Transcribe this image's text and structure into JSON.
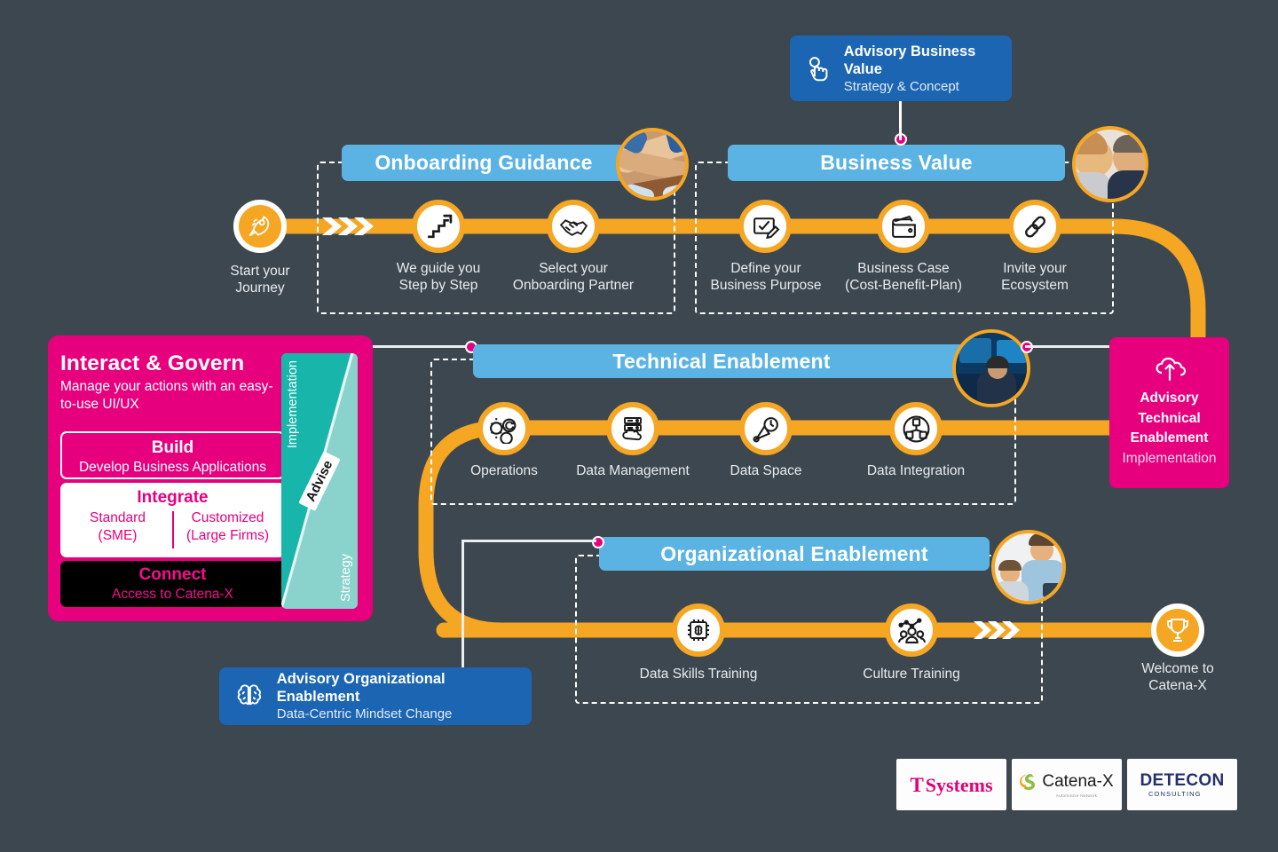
{
  "background_color": "#3d4750",
  "palette": {
    "orange": "#f5a623",
    "blue_bar": "#5bb3e4",
    "advisory_blue": "#1b65b3",
    "pink": "#e6007e",
    "teal_dark": "#18b5ab",
    "teal_light": "#8ad3cd"
  },
  "callouts": {
    "business_value": {
      "icon": "click-hand-icon",
      "title": "Advisory Business Value",
      "subtitle": "Strategy & Concept"
    },
    "organizational": {
      "icon": "brain-icon",
      "title": "Advisory Organizational Enablement",
      "subtitle": "Data-Centric Mindset Change"
    },
    "technical": {
      "icon": "cloud-upload-icon",
      "title": "Advisory Technical Enablement",
      "title_lines": [
        "Advisory",
        "Technical",
        "Enablement"
      ],
      "subtitle": "Implementation"
    }
  },
  "sections": [
    {
      "id": "onboarding",
      "label": "Onboarding Guidance"
    },
    {
      "id": "business-value",
      "label": "Business Value"
    },
    {
      "id": "technical-enablement",
      "label": "Technical Enablement"
    },
    {
      "id": "organizational-enablement",
      "label": "Organizational Enablement"
    }
  ],
  "nodes": {
    "start": {
      "label": "Start your\nJourney",
      "icon": "rocket-icon"
    },
    "guide": {
      "label": "We guide you\nStep by Step",
      "icon": "stairs-arrow-icon"
    },
    "partner": {
      "label": "Select your\nOnboarding Partner",
      "icon": "handshake-icon"
    },
    "purpose": {
      "label": "Define your\nBusiness Purpose",
      "icon": "checklist-pen-icon"
    },
    "business_case": {
      "label": "Business Case\n(Cost-Benefit-Plan)",
      "icon": "wallet-icon"
    },
    "ecosystem": {
      "label": "Invite your\nEcosystem",
      "icon": "chain-link-icon"
    },
    "operations": {
      "label": "Operations",
      "icon": "gear-refresh-icon"
    },
    "data_management": {
      "label": "Data Management",
      "icon": "server-cloud-icon"
    },
    "data_space": {
      "label": "Data Space",
      "icon": "satellite-dish-icon"
    },
    "data_integration": {
      "label": "Data Integration",
      "icon": "network-nodes-icon"
    },
    "data_skills": {
      "label": "Data Skills Training",
      "icon": "ai-chip-brain-icon"
    },
    "culture": {
      "label": "Culture Training",
      "icon": "people-chart-icon"
    },
    "welcome": {
      "label": "Welcome to\nCatena-X",
      "icon": "trophy-icon"
    }
  },
  "govern_panel": {
    "title": "Interact & Govern",
    "subtitle": "Manage your actions with\nan easy-to-use UI/UX",
    "build": {
      "title": "Build",
      "subtitle": "Develop Business Applications"
    },
    "integrate": {
      "title": "Integrate",
      "left": "Standard\n(SME)",
      "right": "Customized\n(Large Firms)"
    },
    "connect": {
      "title": "Connect",
      "subtitle": "Access to Catena-X"
    },
    "wedge": {
      "top_label": "Implementation",
      "bottom_label": "Strategy",
      "center_label": "Advise"
    }
  },
  "logos": [
    {
      "id": "t-systems",
      "mark": "T",
      "name": "Systems",
      "color": "#e20074"
    },
    {
      "id": "catena-x",
      "name": "Catena-X",
      "subtitle": "Automotive Network",
      "color": "#1b1b1b"
    },
    {
      "id": "detecon",
      "name": "DETECON",
      "subtitle": "CONSULTING",
      "color": "#23306b"
    }
  ]
}
